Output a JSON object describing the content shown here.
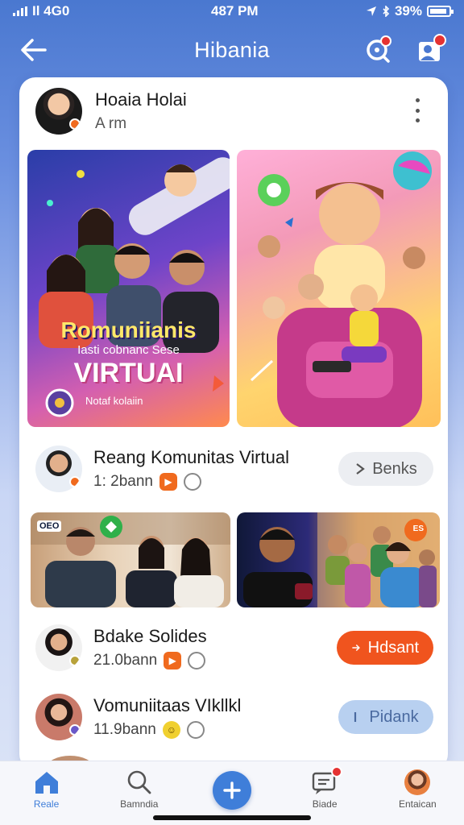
{
  "status": {
    "time": "487 PM",
    "carrier": "Il 4G0",
    "battery": "39%"
  },
  "app": {
    "title": "Hibania"
  },
  "post": {
    "author": "Hoaia Holai",
    "time": "A rm"
  },
  "banner": {
    "title": "Romuniianis",
    "subtitle": "Iasti cobnanc Sese",
    "big": "VIRTUAI",
    "footer": "Notaf kolaiin"
  },
  "list": [
    {
      "title": "Reang Komunitas Virtual",
      "sub": "1: 2bann",
      "button": "Benks",
      "button_style": "gray"
    },
    {
      "title": "Bdake Solides",
      "sub": "21.0bann",
      "button": "Hdsant",
      "button_style": "orange"
    },
    {
      "title": "Vomuniitaas VIkllkl",
      "sub": "11.9bann",
      "button": "Pidank",
      "button_style": "blue"
    }
  ],
  "photo_badges": {
    "left": "OEO",
    "right": "ES"
  },
  "nav": [
    {
      "label": "Reale",
      "icon": "home-icon"
    },
    {
      "label": "Bamndia",
      "icon": "search-icon"
    },
    {
      "label": "",
      "icon": "plus-icon"
    },
    {
      "label": "Biade",
      "icon": "chat-icon"
    },
    {
      "label": "Entaican",
      "icon": "profile-icon"
    }
  ],
  "colors": {
    "accent": "#3f7ed9",
    "orange": "#f0541e",
    "notification": "#e53232"
  }
}
